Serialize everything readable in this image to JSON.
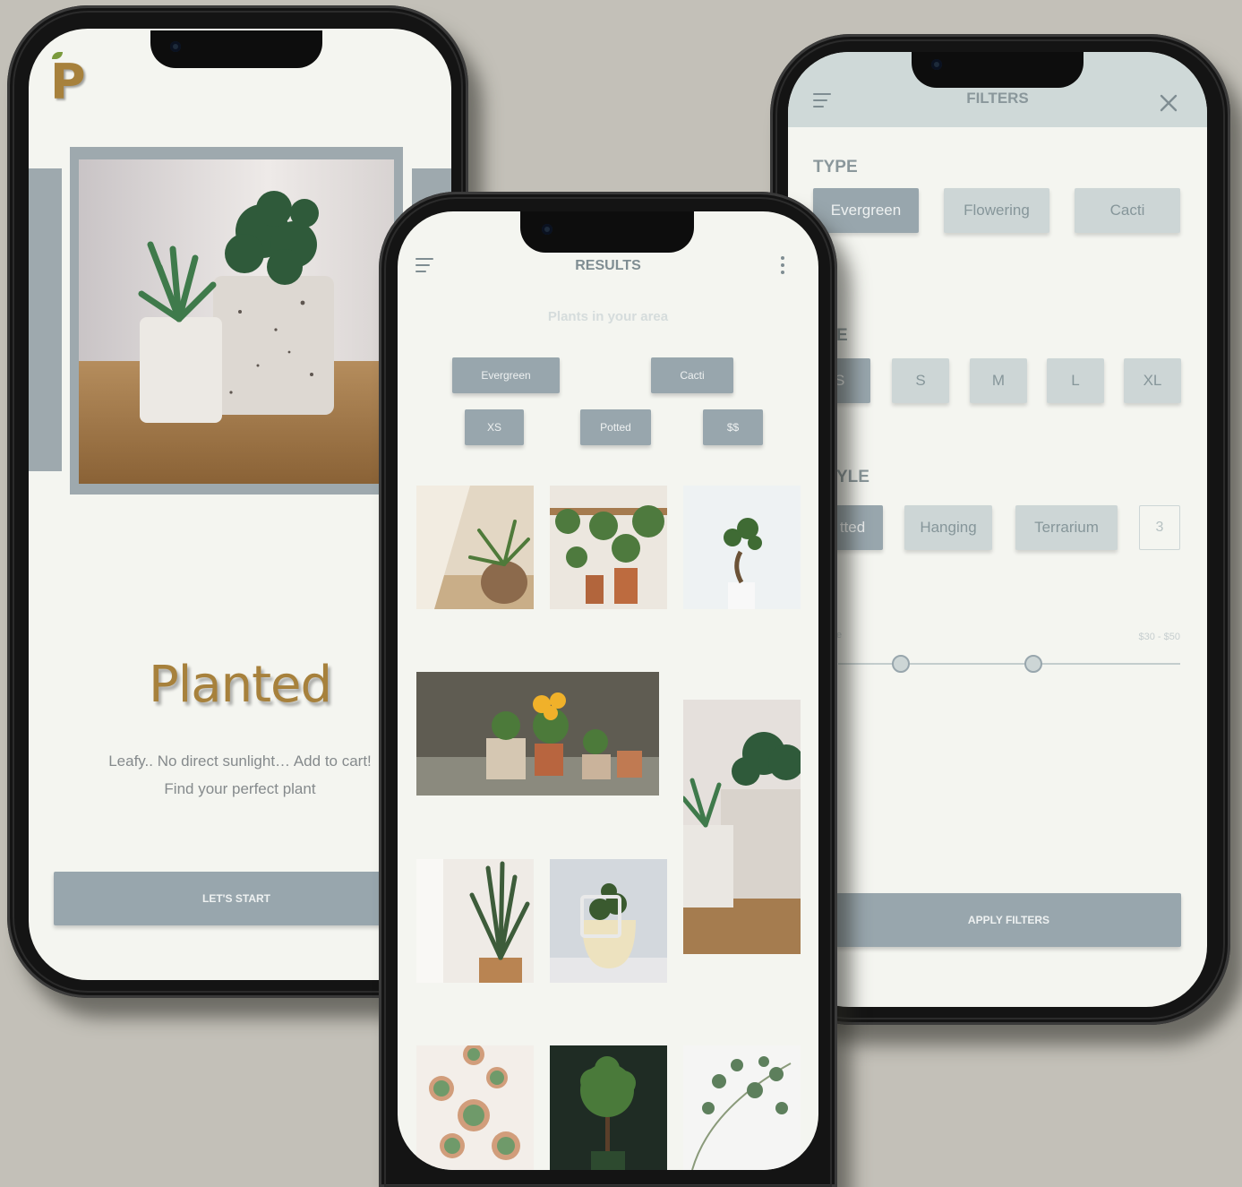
{
  "colors": {
    "background": "#c3c0b8",
    "screen": "#f4f5f0",
    "accent": "#98a6ad",
    "chip_light": "#cdd6d6",
    "brand_gold": "#a7813c"
  },
  "welcome_screen": {
    "logo_letter": "P",
    "brand_name": "Planted",
    "tagline": "Leafy.. No direct sunlight… Add to cart!",
    "subtitle": "Find your perfect plant",
    "cta_label": "LET'S START"
  },
  "results_screen": {
    "title": "RESULTS",
    "section_heading": "Plants in your area",
    "active_filters": [
      "Evergreen",
      "Cacti",
      "XS",
      "Potted",
      "$$"
    ],
    "menu_icon": "hamburger-icon",
    "more_icon": "vertical-dots-icon"
  },
  "filters_screen": {
    "title": "FILTERS",
    "type_heading": "TYPE",
    "type_options": [
      "Evergreen",
      "Flowering",
      "Cacti"
    ],
    "size_heading_partial": "E",
    "size_options": [
      "S",
      "M",
      "L",
      "XL"
    ],
    "size_partial_option": "S",
    "style_heading_partial": "YLE",
    "style_options": [
      "Hanging",
      "Terrarium"
    ],
    "style_partial_option": "tted",
    "style_more_glyph": "3",
    "price_label_partial": "e",
    "price_range": "$30 - $50",
    "slider_values": [
      30,
      50
    ],
    "apply_label": "APPLY FILTERS",
    "close_icon": "close-icon"
  }
}
